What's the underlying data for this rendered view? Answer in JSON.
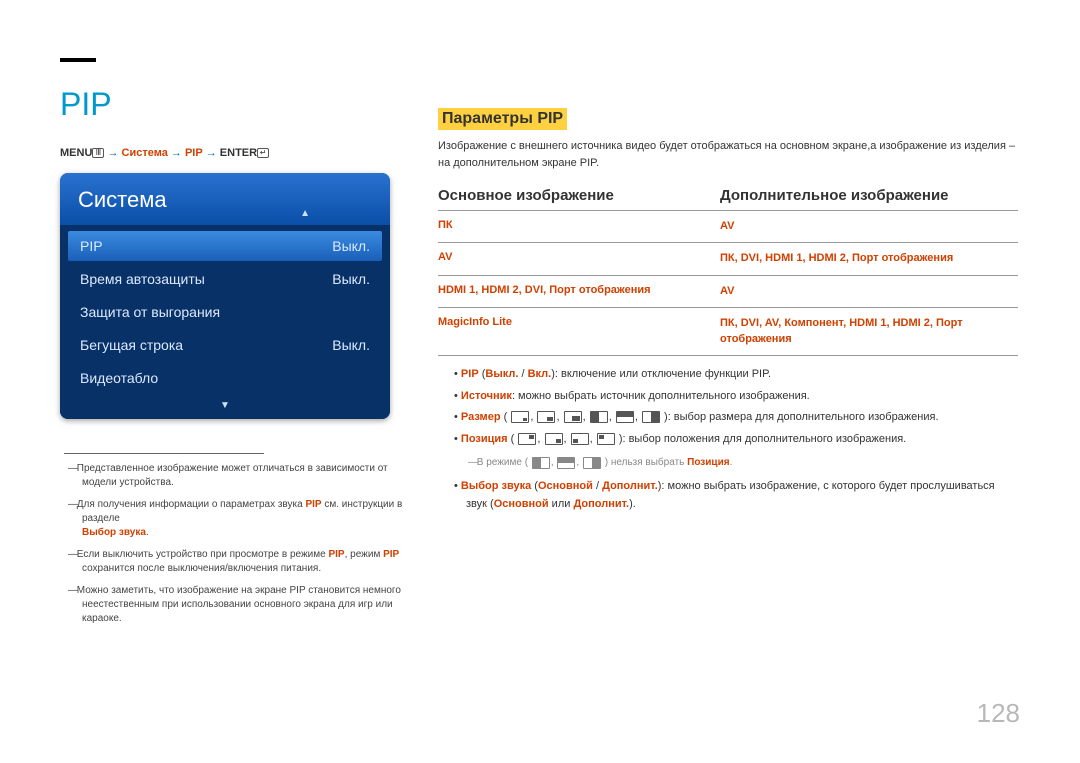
{
  "page_title": "PIP",
  "breadcrumb": {
    "menu": "MENU",
    "arr1": "→",
    "system": "Система",
    "arr2": "→",
    "pip": "PIP",
    "arr3": "→",
    "enter": "ENTER"
  },
  "menu": {
    "header": "Система",
    "items": [
      {
        "label": "PIP",
        "value": "Выкл."
      },
      {
        "label": "Время автозащиты",
        "value": "Выкл."
      },
      {
        "label": "Защита от выгорания",
        "value": ""
      },
      {
        "label": "Бегущая строка",
        "value": "Выкл."
      },
      {
        "label": "Видеотабло",
        "value": ""
      }
    ]
  },
  "notes": {
    "n1": "Представленное изображение может отличаться в зависимости от модели устройства.",
    "n2_a": "Для получения информации о параметрах звука ",
    "n2_pip": "PIP",
    "n2_b": " см. инструкции в разделе ",
    "n2_red": "Выбор звука",
    "n2_c": ".",
    "n3_a": "Если выключить устройство при просмотре в режиме ",
    "n3_pip1": "PIP",
    "n3_b": ", режим ",
    "n3_pip2": "PIP",
    "n3_c": " сохранится после выключения/включения питания.",
    "n4": "Можно заметить, что изображение на экране PIP становится немного неестественным при использовании основного экрана для игр или караоке."
  },
  "section": {
    "title": "Параметры PIP",
    "desc": "Изображение с внешнего источника видео будет отображаться на основном экране,а изображение из изделия – на дополнительном экране PIP.",
    "left_header": "Основное изображение",
    "right_header": "Дополнительное изображение",
    "rows": [
      {
        "left": "ПК",
        "right": "AV"
      },
      {
        "left": "AV",
        "right": "ПК, DVI, HDMI 1, HDMI 2, Порт отображения"
      },
      {
        "left": "HDMI 1, HDMI 2, DVI, Порт отображения",
        "right": "AV"
      },
      {
        "left": "MagicInfo Lite",
        "right": "ПК, DVI, AV, Компонент, HDMI 1, HDMI 2, Порт отображения"
      }
    ]
  },
  "bullets": {
    "b1_red": "PIP",
    "b1_a": " (",
    "b1_off": "Выкл.",
    "b1_b": " / ",
    "b1_on": "Вкл.",
    "b1_c": "): включение или отключение функции PIP.",
    "b2_red": "Источник",
    "b2_a": ": можно выбрать источник дополнительного изображения.",
    "b3_red": "Размер",
    "b3_a": " (",
    "b3_b": "): выбор размера для дополнительного изображения.",
    "b4_red": "Позиция",
    "b4_a": " (",
    "b4_b": "): выбор положения для дополнительного изображения.",
    "b4_note_a": "В режиме (",
    "b4_note_b": ") нельзя выбрать ",
    "b4_note_red": "Позиция",
    "b4_note_c": ".",
    "b5_red1": "Выбор звука",
    "b5_a": " (",
    "b5_red2": "Основной",
    "b5_b": " / ",
    "b5_red3": "Дополнит.",
    "b5_c": "): можно выбрать изображение, с которого будет прослушиваться звук (",
    "b5_red4": "Основной",
    "b5_d": " или ",
    "b5_red5": "Дополнит.",
    "b5_e": ")."
  },
  "page_number": "128"
}
